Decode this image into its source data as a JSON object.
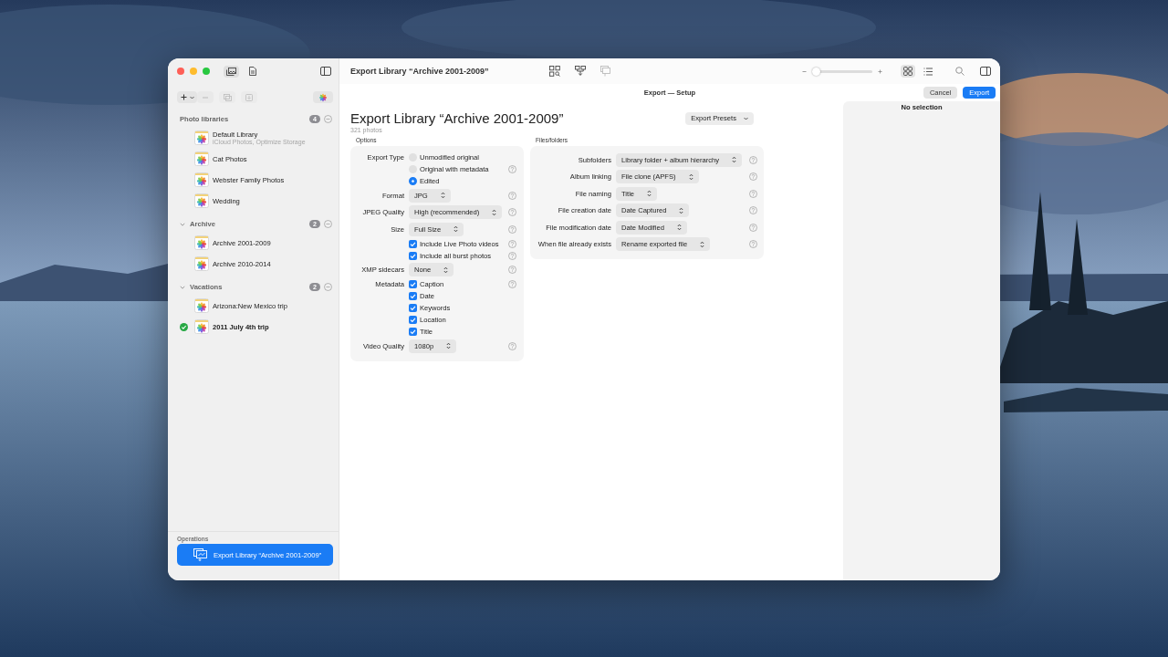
{
  "window": {
    "title": "Export Library “Archive 2001-2009”"
  },
  "toolbar": {
    "mode_buttons": [
      {
        "kind": "library",
        "selected": true
      },
      {
        "kind": "document",
        "selected": false
      }
    ],
    "zoom_slider": {
      "level": 0.06
    },
    "view_modes": [
      {
        "kind": "grid",
        "selected": true
      },
      {
        "kind": "list",
        "selected": false
      }
    ]
  },
  "sidebar": {
    "sections": [
      {
        "title": "Photo libraries",
        "count": "4",
        "items": [
          {
            "name": "Default Library",
            "subtitle": "iCloud Photos, Optimize Storage",
            "current": false
          },
          {
            "name": "Cat Photos",
            "current": false
          },
          {
            "name": "Webster Family Photos",
            "current": false
          },
          {
            "name": "Wedding",
            "current": false
          }
        ]
      },
      {
        "title": "Archive",
        "count": "2",
        "expanded": true,
        "items": [
          {
            "name": "Archive 2001-2009",
            "current": false
          },
          {
            "name": "Archive 2010-2014",
            "current": false
          }
        ]
      },
      {
        "title": "Vacations",
        "count": "2",
        "expanded": true,
        "items": [
          {
            "name": "Arizona:New Mexico trip",
            "current": false
          },
          {
            "name": "2011 July 4th trip",
            "current": true
          }
        ]
      }
    ],
    "operations": {
      "title": "Operations",
      "items": [
        {
          "label": "Export Library “Archive 2001-2009”",
          "selected": true
        }
      ]
    }
  },
  "sheet": {
    "title": "Export — Setup",
    "buttons": [
      {
        "label": "Cancel",
        "kind": "secondary"
      },
      {
        "label": "Export",
        "kind": "primary"
      }
    ]
  },
  "export_setup": {
    "heading": "Export Library “Archive 2001-2009”",
    "photo_count": "321 photos",
    "presets_button": "Export Presets",
    "options": {
      "title": "Options",
      "rows": [
        {
          "label": "Export Type",
          "kind": "radio",
          "text": "Unmodified original",
          "selected": false,
          "help": false
        },
        {
          "kind": "radio",
          "text": "Original with metadata",
          "selected": false,
          "help": true
        },
        {
          "kind": "radio",
          "text": "Edited",
          "selected": true,
          "help": false
        },
        {
          "label": "Format",
          "kind": "popup",
          "value": "JPG",
          "help": true
        },
        {
          "label": "JPEG Quality",
          "kind": "popup",
          "value": "High (recommended)",
          "help": true
        },
        {
          "label": "Size",
          "kind": "popup",
          "value": "Full Size",
          "help": true
        },
        {
          "kind": "check",
          "text": "Include Live Photo videos",
          "checked": true,
          "help": true
        },
        {
          "kind": "check",
          "text": "Include all burst photos",
          "checked": true,
          "help": true
        },
        {
          "label": "XMP sidecars",
          "kind": "popup",
          "value": "None",
          "help": true
        },
        {
          "label": "Metadata",
          "kind": "check",
          "text": "Caption",
          "checked": true,
          "help": true
        },
        {
          "kind": "check",
          "text": "Date",
          "checked": true,
          "help": false
        },
        {
          "kind": "check",
          "text": "Keywords",
          "checked": true,
          "help": false
        },
        {
          "kind": "check",
          "text": "Location",
          "checked": true,
          "help": false
        },
        {
          "kind": "check",
          "text": "Title",
          "checked": true,
          "help": false
        },
        {
          "label": "Video Quality",
          "kind": "popup",
          "value": "1080p",
          "help": true
        }
      ]
    },
    "files": {
      "title": "Files/folders",
      "rows": [
        {
          "label": "Subfolders",
          "kind": "popup",
          "value": "Library folder + album hierarchy",
          "help": true
        },
        {
          "label": "Album linking",
          "kind": "popup",
          "value": "File clone (APFS)",
          "help": true
        },
        {
          "label": "File naming",
          "kind": "popup",
          "value": "Title",
          "help": true
        },
        {
          "label": "File creation date",
          "kind": "popup",
          "value": "Date Captured",
          "help": true
        },
        {
          "label": "File modification date",
          "kind": "popup",
          "value": "Date Modified",
          "help": true
        },
        {
          "label": "When file already exists",
          "kind": "popup",
          "value": "Rename exported file",
          "help": true
        }
      ]
    }
  },
  "inspector": {
    "message": "No selection"
  }
}
